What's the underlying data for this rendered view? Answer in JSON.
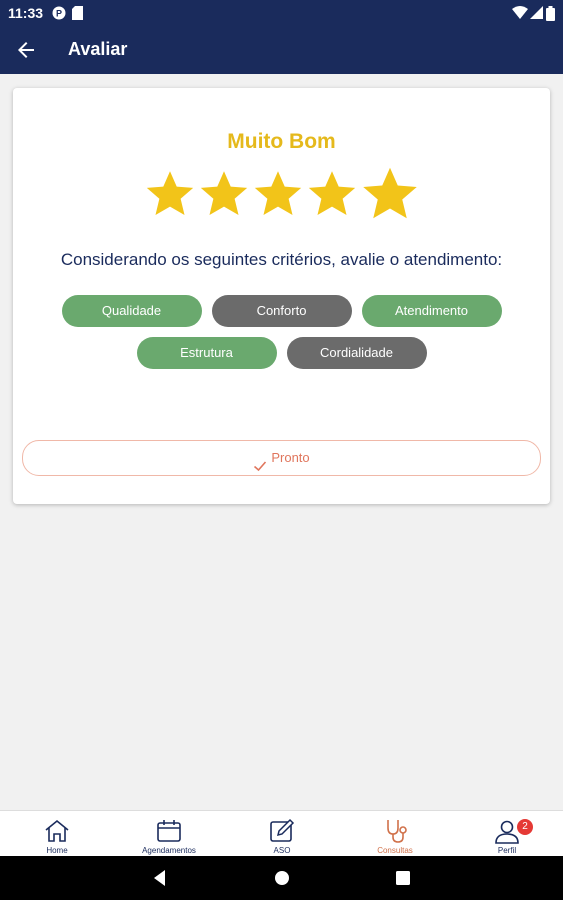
{
  "status_bar": {
    "time": "11:33"
  },
  "app_bar": {
    "title": "Avaliar"
  },
  "rating": {
    "label": "Muito Bom",
    "value": 5,
    "max": 5,
    "star_color": "#f2c419"
  },
  "question": "Considerando os seguintes critérios, avalie o atendimento:",
  "criteria": [
    {
      "label": "Qualidade",
      "selected": true
    },
    {
      "label": "Conforto",
      "selected": false
    },
    {
      "label": "Atendimento",
      "selected": true
    },
    {
      "label": "Estrutura",
      "selected": true
    },
    {
      "label": "Cordialidade",
      "selected": false
    }
  ],
  "done_button": {
    "label": "Pronto"
  },
  "bottom_nav": [
    {
      "label": "Home",
      "icon": "home-icon"
    },
    {
      "label": "Agendamentos",
      "icon": "calendar-icon"
    },
    {
      "label": "ASO",
      "icon": "edit-document-icon"
    },
    {
      "label": "Consultas",
      "icon": "stethoscope-icon",
      "active": true
    },
    {
      "label": "Perfil",
      "icon": "profile-icon",
      "badge": "2"
    }
  ],
  "colors": {
    "primary": "#1a2b5c",
    "accent": "#d0714a",
    "chip_selected": "#6aa96e",
    "chip_unselected": "#6b6b6b",
    "rating_label": "#e5b91c"
  }
}
